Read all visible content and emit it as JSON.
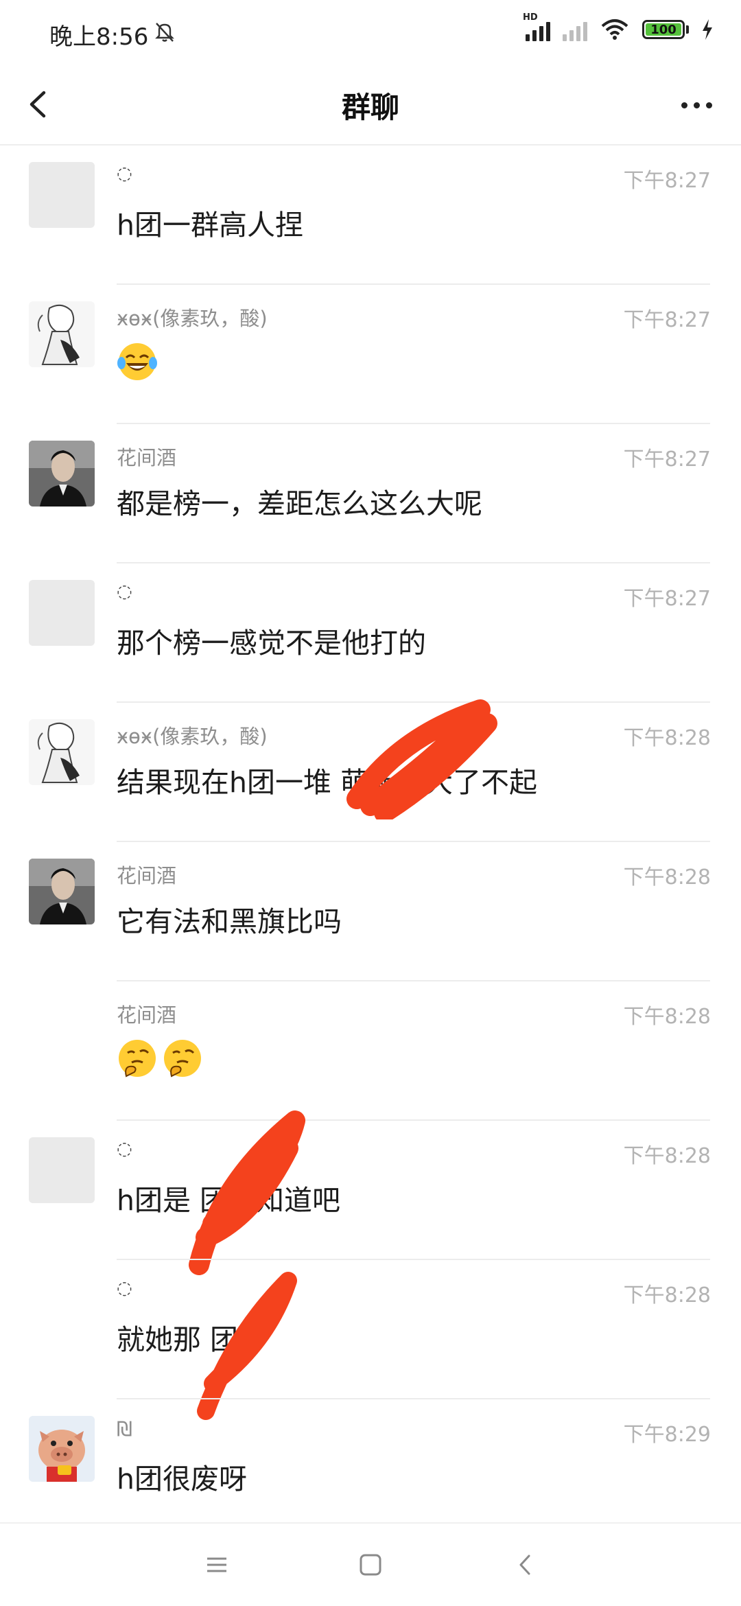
{
  "status_bar": {
    "time": "晚上8:56",
    "battery": "100",
    "network": "HD"
  },
  "header": {
    "title": "群聊"
  },
  "messages": [
    {
      "sender": "◌",
      "time": "下午8:27",
      "text": "h团一群高人捏",
      "avatar": "blank"
    },
    {
      "sender": "ӿɵӿ(像素玖，酸)",
      "time": "下午8:27",
      "text": "",
      "emoji": [
        "tears-of-joy-emoji"
      ],
      "avatar": "manga-girl"
    },
    {
      "sender": "花间酒",
      "time": "下午8:27",
      "text": "都是榜一，差距怎么这么大呢",
      "avatar": "man-suit"
    },
    {
      "sender": "◌",
      "time": "下午8:27",
      "text": "那个榜一感觉不是他打的",
      "avatar": "blank"
    },
    {
      "sender": "ӿɵӿ(像素玖，酸)",
      "time": "下午8:28",
      "text": "结果现在h团一堆 萌新自大了不起",
      "avatar": "manga-girl"
    },
    {
      "sender": "花间酒",
      "time": "下午8:28",
      "text": "它有法和黑旗比吗",
      "avatar": "man-suit"
    },
    {
      "sender": "花间酒",
      "time": "下午8:28",
      "text": "",
      "emoji": [
        "thinking-emoji",
        "thinking-emoji"
      ],
      "avatar": "none"
    },
    {
      "sender": "◌",
      "time": "下午8:28",
      "text": "h团是 团你知道吧",
      "avatar": "blank"
    },
    {
      "sender": "◌",
      "time": "下午8:28",
      "text": "就她那 团",
      "avatar": "none"
    },
    {
      "sender": "₪",
      "time": "下午8:29",
      "text": "h团很废呀",
      "avatar": "cartoon-pig"
    }
  ],
  "navbar": {
    "icons": [
      "menu-icon",
      "home-square-icon",
      "back-triangle-icon"
    ]
  },
  "colors": {
    "redaction": "#f4421d",
    "battery_green": "#55c13b"
  }
}
